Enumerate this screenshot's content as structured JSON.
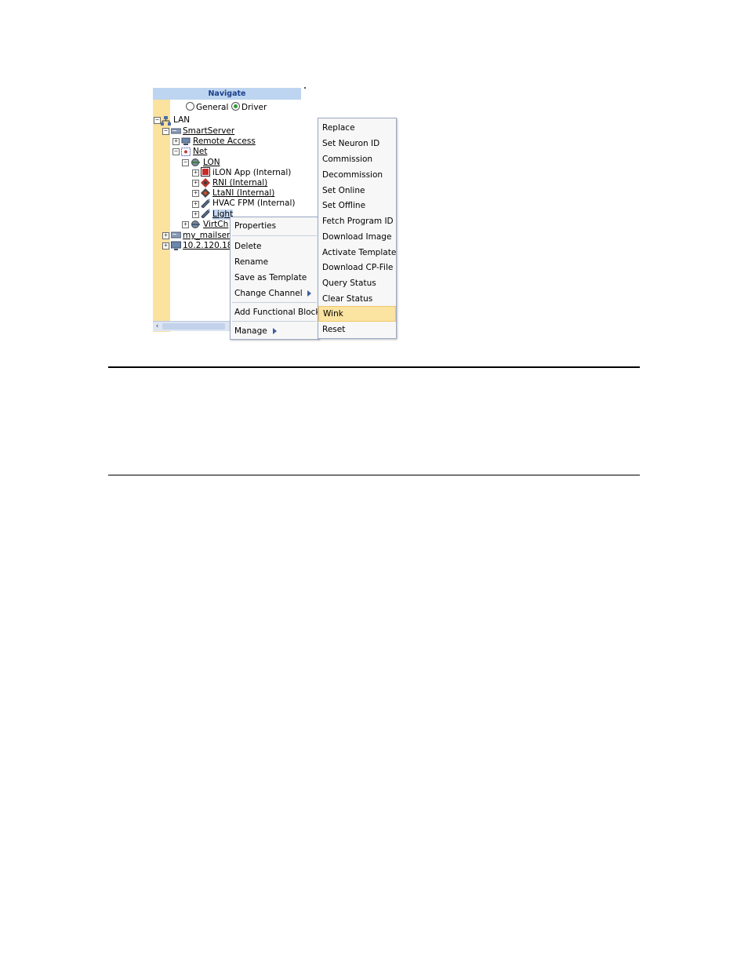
{
  "navigate": {
    "title": "Navigate",
    "view_modes": [
      {
        "label": "General",
        "selected": false
      },
      {
        "label": "Driver",
        "selected": true
      }
    ]
  },
  "tree": {
    "lan": "LAN",
    "smartserver": "SmartServer",
    "remote_access": "Remote Access",
    "net": "Net",
    "lon": "LON",
    "ilon_app": "iLON App (Internal)",
    "rni": "RNI (Internal)",
    "ltani": "LtaNI (Internal)",
    "hvac_fpm": "HVAC FPM (Internal)",
    "light": "Light",
    "virtch": "VirtCh",
    "mailserver": "my_mailserv",
    "ip_device": "10.2.120.18"
  },
  "context_menu": {
    "properties": "Properties",
    "delete": "Delete",
    "rename": "Rename",
    "save_as_template": "Save as Template",
    "change_channel": "Change Channel",
    "add_functional_block": "Add Functional Block",
    "manage": "Manage"
  },
  "manage_submenu": {
    "items": [
      "Replace",
      "Set Neuron ID",
      "Commission",
      "Decommission",
      "Set Online",
      "Set Offline",
      "Fetch Program ID",
      "Download Image",
      "Activate Template",
      "Download CP-File",
      "Query Status",
      "Clear Status",
      "Wink",
      "Reset"
    ],
    "highlighted": "Wink"
  },
  "colors": {
    "header_bg": "#bdd5f0",
    "header_text": "#1b3f8b",
    "left_strip": "#fbe29f",
    "menu_highlight": "#fbe3a1"
  }
}
